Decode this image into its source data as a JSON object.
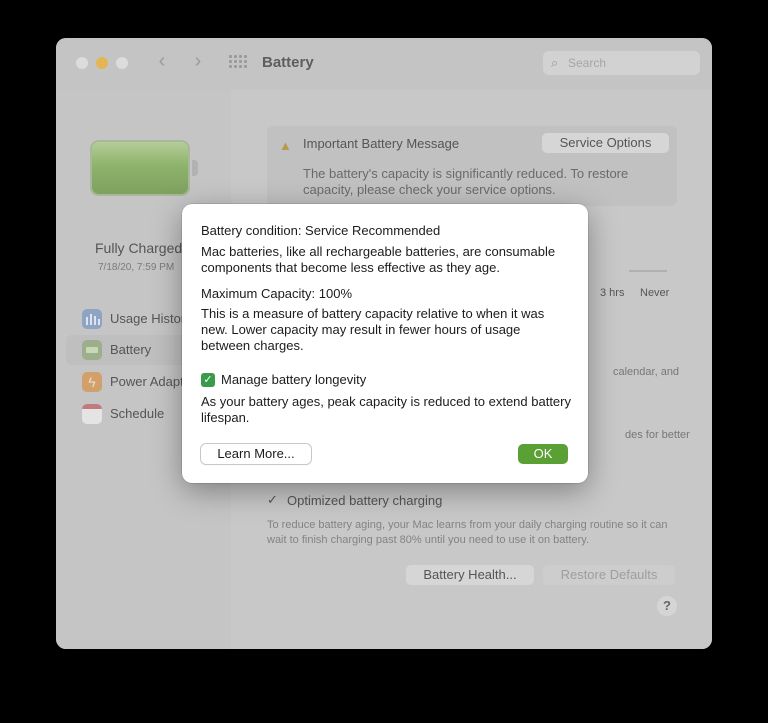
{
  "window": {
    "title": "Battery",
    "search_placeholder": "Search",
    "back_glyph": "‹",
    "forward_glyph": "›"
  },
  "sidebar": {
    "status_title": "Fully Charged",
    "status_date": "7/18/20, 7:59 PM",
    "items": [
      {
        "label": "Usage History",
        "icon": "usage-history-icon"
      },
      {
        "label": "Battery",
        "icon": "battery-icon",
        "selected": true
      },
      {
        "label": "Power Adapter",
        "icon": "power-adapter-icon"
      },
      {
        "label": "Schedule",
        "icon": "schedule-icon"
      }
    ]
  },
  "main": {
    "message_title": "Important Battery Message",
    "service_button": "Service Options",
    "message_text": "The battery's capacity is significantly reduced. To restore capacity, please check your service options.",
    "tick_3hrs": "3 hrs",
    "tick_never": "Never",
    "fragment_calendar": "calendar, and",
    "fragment_better": "des for better",
    "optimized_label": "Optimized battery charging",
    "optimized_checked": true,
    "optimized_desc": "To reduce battery aging, your Mac learns from your daily charging routine so it can wait to finish charging past 80% until you need to use it on battery.",
    "health_button": "Battery Health...",
    "restore_button": "Restore Defaults",
    "help_label": "?"
  },
  "dialog": {
    "condition": "Battery condition: Service Recommended",
    "intro": "Mac batteries, like all rechargeable batteries, are consumable components that become less effective as they age.",
    "max_capacity": "Maximum Capacity: 100%",
    "capacity_desc": "This is a measure of battery capacity relative to when it was new. Lower capacity may result in fewer hours of usage between charges.",
    "manage_label": "Manage battery longevity",
    "manage_checked": true,
    "manage_desc": "As your battery ages, peak capacity is reduced to extend battery lifespan.",
    "learn_button": "Learn More...",
    "ok_button": "OK"
  },
  "colors": {
    "ok_accent": "#5aa034",
    "checkbox": "#3a9b4a",
    "battery_green": "#8eb36c"
  }
}
